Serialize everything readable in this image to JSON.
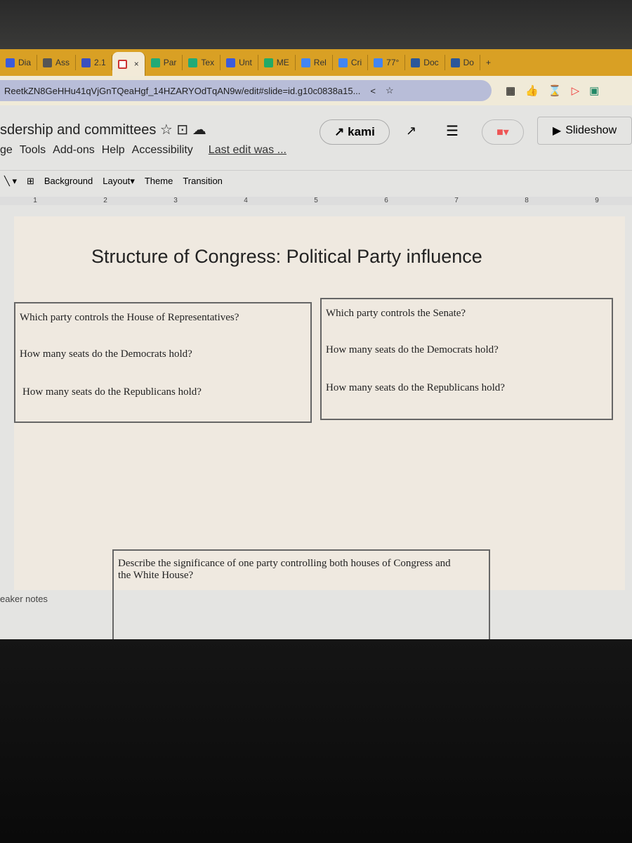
{
  "browser": {
    "tabs": [
      {
        "label": "Dia",
        "color": "#3b5bdb"
      },
      {
        "label": "Ass",
        "color": "#555"
      },
      {
        "label": "2.1",
        "color": "#3b4fbf"
      },
      {
        "label": "",
        "color": "#c33",
        "active": true
      },
      {
        "label": "Par",
        "color": "#2a7"
      },
      {
        "label": "Tex",
        "color": "#2a7"
      },
      {
        "label": "Unt",
        "color": "#3b5bdb"
      },
      {
        "label": "ME",
        "color": "#2a6"
      },
      {
        "label": "Rel",
        "color": "#4285f4"
      },
      {
        "label": "Cri",
        "color": "#4285f4"
      },
      {
        "label": "77°",
        "color": "#4285f4"
      },
      {
        "label": "Doc",
        "color": "#2b579a"
      },
      {
        "label": "Do",
        "color": "#2b579a"
      }
    ],
    "close": "×",
    "new_tab": "+",
    "url": "ReetkZN8GeHHu41qVjGnTQeaHgf_14HZARYOdTqAN9w/edit#slide=id.g10c0838a15...",
    "share": "<",
    "star": "☆"
  },
  "doc": {
    "title": "sdership and committees",
    "menu": [
      "ge",
      "Tools",
      "Add-ons",
      "Help",
      "Accessibility"
    ],
    "last_edit": "Last edit was ...",
    "kami": "kami",
    "slideshow": "Slideshow"
  },
  "toolbar": [
    "Background",
    "Layout",
    "Theme",
    "Transition"
  ],
  "ruler": [
    "1",
    "2",
    "3",
    "4",
    "5",
    "6",
    "7",
    "8",
    "9"
  ],
  "slide": {
    "title": "Structure of Congress: Political Party influence",
    "house": [
      "Which party controls the House of Representatives?",
      "How many seats do the Democrats hold?",
      "How many seats do the Republicans hold?"
    ],
    "senate": [
      "Which party controls the Senate?",
      "How many seats do the Democrats hold?",
      "How many seats do the Republicans hold?"
    ],
    "describe": "Describe the significance of one party controlling both houses of Congress and the White House?"
  },
  "notes": "eaker notes"
}
